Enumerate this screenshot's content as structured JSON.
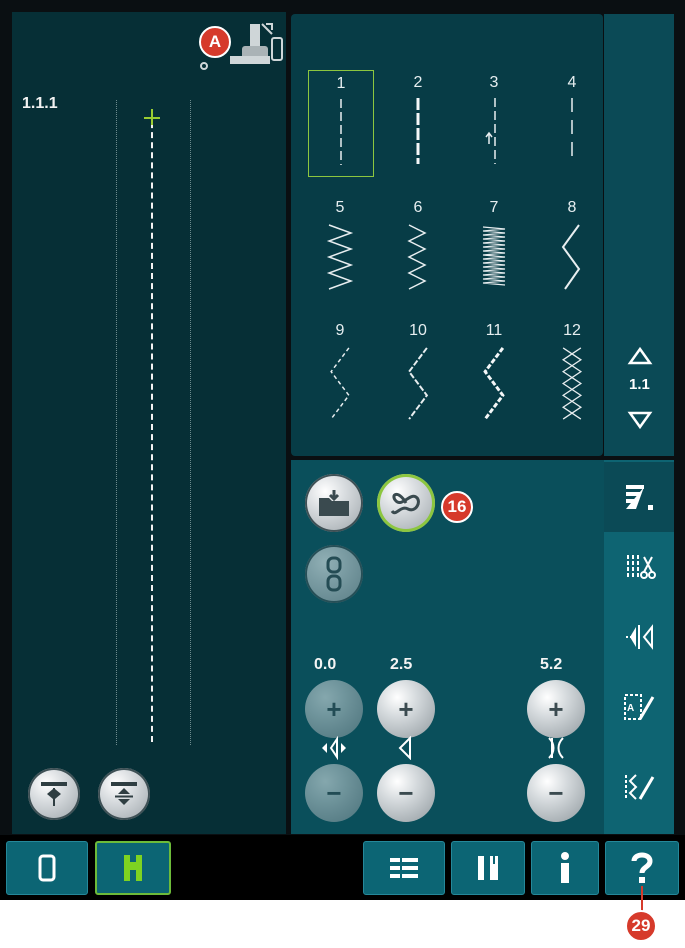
{
  "stitch_id": "1.1.1",
  "callouts": {
    "presser_foot": "A",
    "stitch_menu_button": "16",
    "help_button": "29"
  },
  "stitch_grid": {
    "page": "1.1",
    "stitches": [
      {
        "number": "1",
        "selected": true
      },
      {
        "number": "2"
      },
      {
        "number": "3"
      },
      {
        "number": "4"
      },
      {
        "number": "5"
      },
      {
        "number": "6"
      },
      {
        "number": "7"
      },
      {
        "number": "8"
      },
      {
        "number": "9"
      },
      {
        "number": "10"
      },
      {
        "number": "11"
      },
      {
        "number": "12"
      }
    ]
  },
  "settings": {
    "position_value": "0.0",
    "width_value": "2.5",
    "length_value": "5.2"
  },
  "colors": {
    "accent_green": "#8cc63f",
    "callout_red": "#d63a2b",
    "panel_teal": "#073c46"
  }
}
